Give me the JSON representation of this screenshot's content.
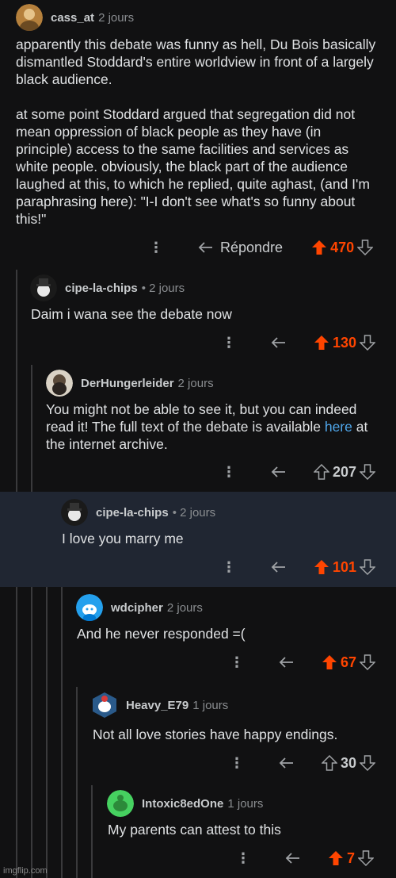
{
  "comments": [
    {
      "username": "cass_at",
      "time": "2 jours",
      "body": [
        "apparently this debate was funny as hell, Du Bois basically dismantled Stoddard's entire worldview in front of a largely black audience.",
        "at some point Stoddard argued that segregation did not mean oppression of black people as they have (in principle) access to the same facilities and services as white people. obviously, the black part of the audience laughed at this, to which he replied, quite aghast, (and I'm paraphrasing here): \"I-I don't see what's so funny about this!\""
      ],
      "reply_label": "Répondre",
      "votes": "470",
      "upvoted": true
    },
    {
      "username": "cipe-la-chips",
      "time": "• 2 jours",
      "body": "Daim i wana see the debate now",
      "votes": "130",
      "upvoted": true
    },
    {
      "username": "DerHungerleider",
      "time": "2 jours",
      "body_before": "You might not be able to see it, but you can indeed read it! The full text of the debate is available ",
      "link_text": "here",
      "body_after": " at the internet archive.",
      "votes": "207",
      "upvoted": false
    },
    {
      "username": "cipe-la-chips",
      "time": "• 2 jours",
      "body": "I love you marry me",
      "votes": "101",
      "upvoted": true
    },
    {
      "username": "wdcipher",
      "time": "2 jours",
      "body": "And he never responded =(",
      "votes": "67",
      "upvoted": true
    },
    {
      "username": "Heavy_E79",
      "time": "1 jours",
      "body": "Not all love stories have happy endings.",
      "votes": "30",
      "upvoted": false
    },
    {
      "username": "Intoxic8edOne",
      "time": "1 jours",
      "body": "My parents can attest to this",
      "votes": "7",
      "upvoted": true
    }
  ],
  "colors": {
    "upvote": "#ff4500",
    "background": "#111112",
    "highlight": "#202632",
    "link": "#4fa6ea"
  },
  "icons": {
    "more": "more-options-icon",
    "reply": "reply-arrow-icon",
    "upvote": "upvote-arrow-icon",
    "downvote": "downvote-arrow-icon"
  },
  "watermark": "imgflip.com"
}
